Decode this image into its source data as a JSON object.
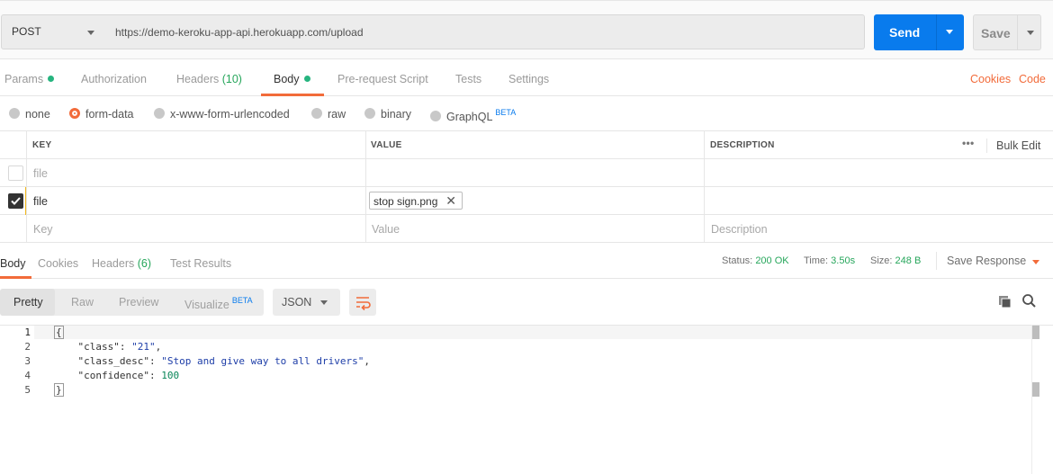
{
  "request": {
    "method": "POST",
    "url": "https://demo-keroku-app-api.herokuapp.com/upload",
    "send_label": "Send",
    "save_label": "Save"
  },
  "request_tabs": [
    {
      "label": "Params",
      "dot": true
    },
    {
      "label": "Authorization"
    },
    {
      "label": "Headers",
      "count": "(10)"
    },
    {
      "label": "Body",
      "dot": true,
      "active": true
    },
    {
      "label": "Pre-request Script"
    },
    {
      "label": "Tests"
    },
    {
      "label": "Settings"
    }
  ],
  "right_links": {
    "cookies": "Cookies",
    "code": "Code"
  },
  "body_types": [
    "none",
    "form-data",
    "x-www-form-urlencoded",
    "raw",
    "binary",
    "GraphQL"
  ],
  "body_selected": "form-data",
  "beta_label": "BETA",
  "table": {
    "headers": {
      "key": "KEY",
      "value": "VALUE",
      "description": "DESCRIPTION"
    },
    "more": "•••",
    "bulk_edit": "Bulk Edit",
    "rows": [
      {
        "checked": false,
        "key": "file",
        "value": "",
        "description": ""
      },
      {
        "checked": true,
        "key": "file",
        "value": "stop sign.png",
        "description": ""
      }
    ],
    "placeholders": {
      "key": "Key",
      "value": "Value",
      "description": "Description"
    }
  },
  "response_tabs": [
    {
      "label": "Body",
      "active": true
    },
    {
      "label": "Cookies"
    },
    {
      "label": "Headers",
      "count": "(6)"
    },
    {
      "label": "Test Results"
    }
  ],
  "status": {
    "status_label": "Status:",
    "status_value": "200 OK",
    "time_label": "Time:",
    "time_value": "3.50s",
    "size_label": "Size:",
    "size_value": "248 B",
    "save_response": "Save Response"
  },
  "view_modes": [
    "Pretty",
    "Raw",
    "Preview",
    "Visualize"
  ],
  "format": "JSON",
  "code_lines": [
    {
      "n": "1",
      "text": "{"
    },
    {
      "n": "2",
      "key": "\"class\"",
      "value": "\"21\"",
      "kind": "str",
      "comma": ","
    },
    {
      "n": "3",
      "key": "\"class_desc\"",
      "value": "\"Stop and give way to all drivers\"",
      "kind": "str",
      "comma": ","
    },
    {
      "n": "4",
      "key": "\"confidence\"",
      "value": "100",
      "kind": "num",
      "comma": ""
    },
    {
      "n": "5",
      "text": "}"
    }
  ],
  "colors": {
    "accent": "#f26b3a",
    "send": "#097bed",
    "ok": "#26a65b",
    "beta": "#097bed"
  }
}
